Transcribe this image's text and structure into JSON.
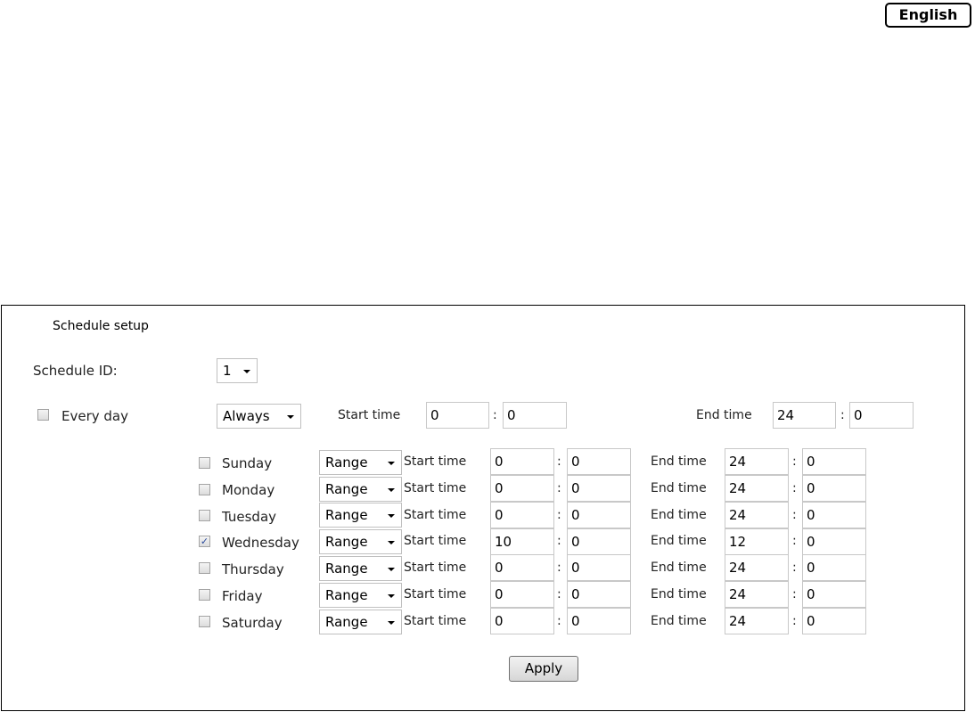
{
  "language_button": "English",
  "panel": {
    "title": "Schedule setup",
    "schedule_id_label": "Schedule ID:",
    "schedule_id_value": "1",
    "every_day": {
      "label": "Every day",
      "checked": false,
      "mode": "Always",
      "start_label": "Start time",
      "start_hour": "0",
      "start_min": "0",
      "end_label": "End time",
      "end_hour": "24",
      "end_min": "0",
      "colon": ":"
    },
    "days": [
      {
        "name": "Sunday",
        "checked": false,
        "mode": "Range",
        "start_label": "Start time",
        "start_hour": "0",
        "start_min": "0",
        "end_label": "End time",
        "end_hour": "24",
        "end_min": "0",
        "colon": ":"
      },
      {
        "name": "Monday",
        "checked": false,
        "mode": "Range",
        "start_label": "Start time",
        "start_hour": "0",
        "start_min": "0",
        "end_label": "End time",
        "end_hour": "24",
        "end_min": "0",
        "colon": ":"
      },
      {
        "name": "Tuesday",
        "checked": false,
        "mode": "Range",
        "start_label": "Start time",
        "start_hour": "0",
        "start_min": "0",
        "end_label": "End time",
        "end_hour": "24",
        "end_min": "0",
        "colon": ":"
      },
      {
        "name": "Wednesday",
        "checked": true,
        "mode": "Range",
        "start_label": "Start time",
        "start_hour": "10",
        "start_min": "0",
        "end_label": "End time",
        "end_hour": "12",
        "end_min": "0",
        "colon": ":"
      },
      {
        "name": "Thursday",
        "checked": false,
        "mode": "Range",
        "start_label": "Start time",
        "start_hour": "0",
        "start_min": "0",
        "end_label": "End time",
        "end_hour": "24",
        "end_min": "0",
        "colon": ":"
      },
      {
        "name": "Friday",
        "checked": false,
        "mode": "Range",
        "start_label": "Start time",
        "start_hour": "0",
        "start_min": "0",
        "end_label": "End time",
        "end_hour": "24",
        "end_min": "0",
        "colon": ":"
      },
      {
        "name": "Saturday",
        "checked": false,
        "mode": "Range",
        "start_label": "Start time",
        "start_hour": "0",
        "start_min": "0",
        "end_label": "End time",
        "end_hour": "24",
        "end_min": "0",
        "colon": ":"
      }
    ],
    "apply_label": "Apply",
    "check_mark": "✓"
  },
  "icons": {
    "dropdown": "chevron-down-icon",
    "check": "checkmark-icon"
  },
  "colors": {
    "checkmark": "#2a4a9c",
    "border": "#000000"
  }
}
